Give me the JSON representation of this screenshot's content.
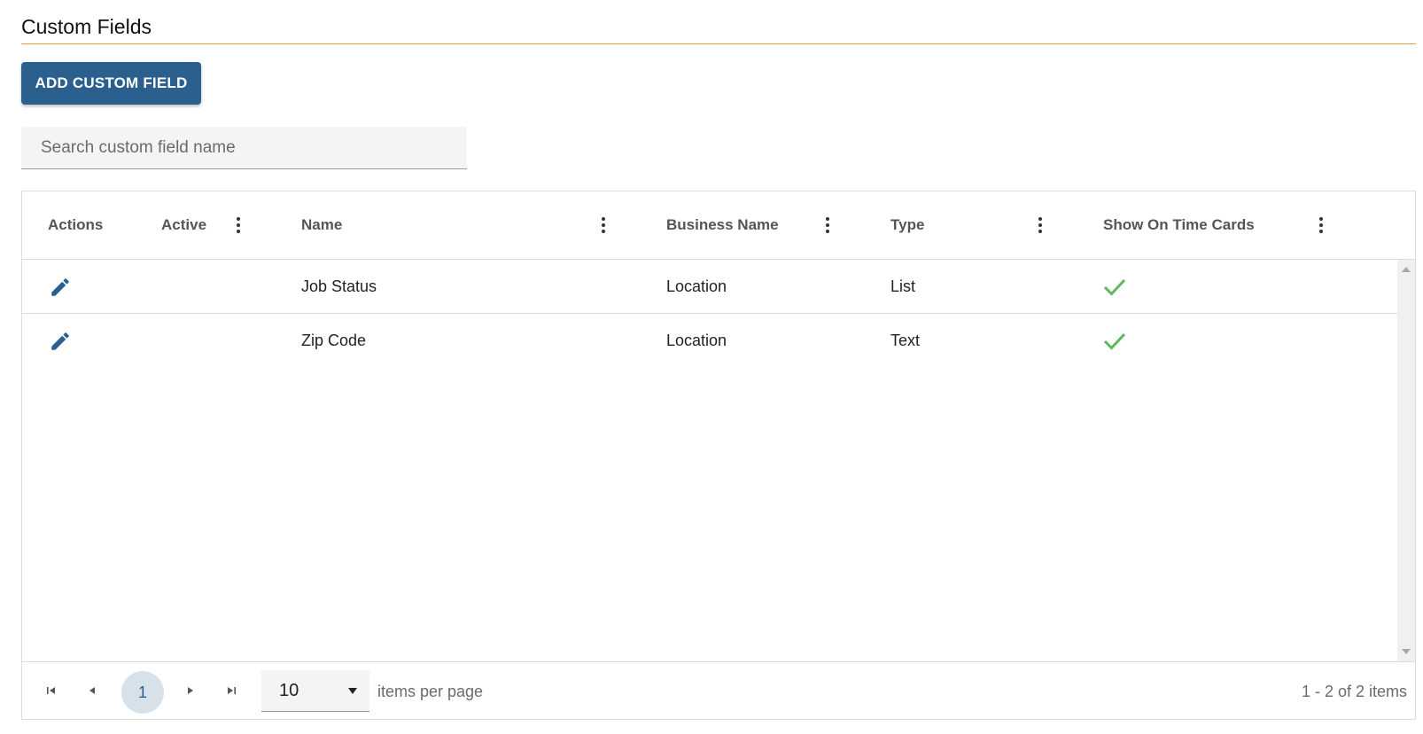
{
  "page": {
    "title": "Custom Fields"
  },
  "toolbar": {
    "add_label": "ADD CUSTOM FIELD"
  },
  "search": {
    "placeholder": "Search custom field name",
    "value": ""
  },
  "grid": {
    "columns": [
      {
        "label": "Actions",
        "has_menu": false
      },
      {
        "label": "Active",
        "has_menu": true
      },
      {
        "label": "Name",
        "has_menu": true
      },
      {
        "label": "Business Name",
        "has_menu": true
      },
      {
        "label": "Type",
        "has_menu": true
      },
      {
        "label": "Show On Time Cards",
        "has_menu": true
      }
    ],
    "rows": [
      {
        "name": "Job Status",
        "business_name": "Location",
        "type": "List",
        "show_on_time_cards": true
      },
      {
        "name": "Zip Code",
        "business_name": "Location",
        "type": "Text",
        "show_on_time_cards": true
      }
    ]
  },
  "pager": {
    "current_page": "1",
    "page_size": "10",
    "items_per_page_label": "items per page",
    "info": "1 - 2 of 2 items"
  },
  "colors": {
    "accent": "#e8a33d",
    "primary": "#2b5f8e",
    "check": "#5cb85c"
  },
  "icons": [
    "pencil-icon",
    "check-icon",
    "kebab-menu-icon",
    "first-page-icon",
    "prev-page-icon",
    "next-page-icon",
    "last-page-icon",
    "dropdown-caret-icon"
  ]
}
